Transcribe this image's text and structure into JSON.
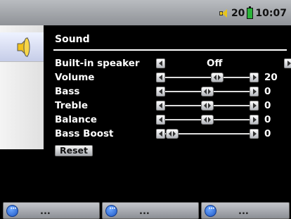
{
  "status": {
    "volume_level": "20",
    "time": "10:07"
  },
  "page": {
    "title": "Sound"
  },
  "settings": {
    "builtin_speaker": {
      "label": "Built-in speaker",
      "value": "Off"
    },
    "volume": {
      "label": "Volume",
      "value": "20"
    },
    "bass": {
      "label": "Bass",
      "value": "0"
    },
    "treble": {
      "label": "Treble",
      "value": "0"
    },
    "balance": {
      "label": "Balance",
      "value": "0"
    },
    "bass_boost": {
      "label": "Bass Boost",
      "value": "0"
    }
  },
  "reset_label": "Reset",
  "function_bar": [
    {
      "label": "...",
      "icon": "more-circle-icon"
    },
    {
      "label": "...",
      "icon": "more-circle-icon"
    },
    {
      "label": "...",
      "icon": "more-circle-icon"
    }
  ],
  "colors": {
    "status_bar": "#a5a8ad",
    "background": "#000000",
    "battery": "#2bb43a",
    "speaker": "#e8c51b",
    "button_icon": "#1d57c5"
  }
}
